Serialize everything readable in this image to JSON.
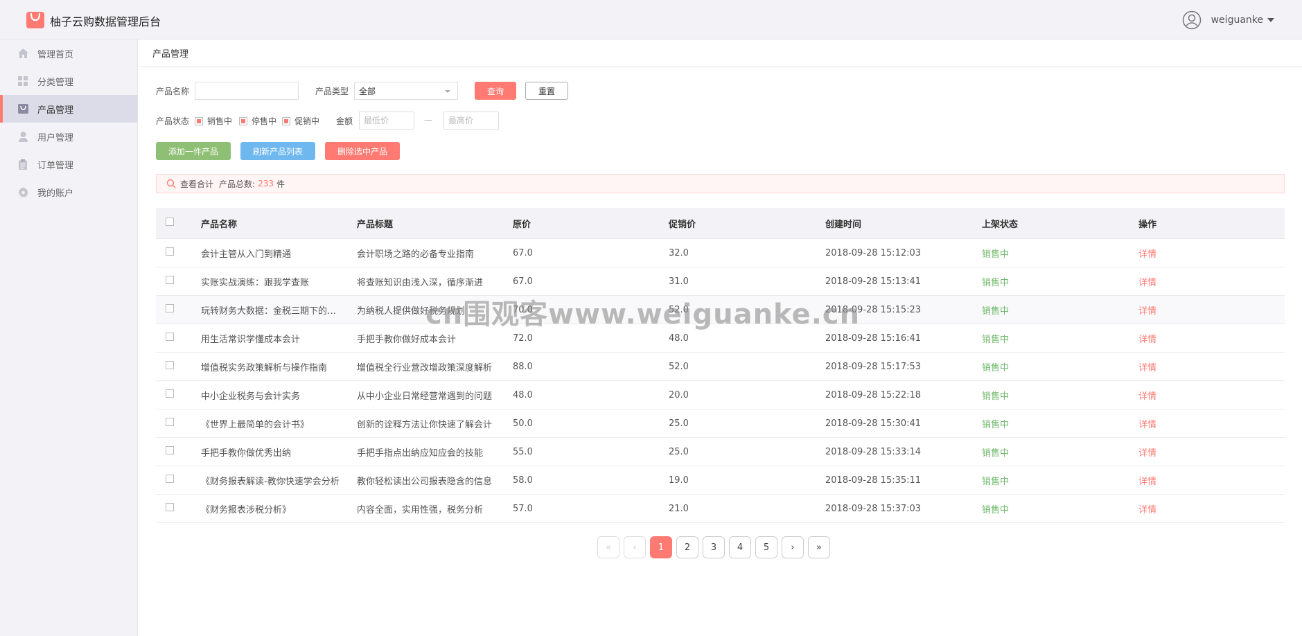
{
  "app": {
    "title": "柚子云购数据管理后台",
    "logo_color": "#ff7a72"
  },
  "user": {
    "name": "weiguanke"
  },
  "sidebar": {
    "items": [
      {
        "label": "管理首页",
        "icon": "home-icon",
        "active": false
      },
      {
        "label": "分类管理",
        "icon": "grid-icon",
        "active": false
      },
      {
        "label": "产品管理",
        "icon": "bag-icon",
        "active": true
      },
      {
        "label": "用户管理",
        "icon": "user-icon",
        "active": false
      },
      {
        "label": "订单管理",
        "icon": "clipboard-icon",
        "active": false
      },
      {
        "label": "我的账户",
        "icon": "gear-icon",
        "active": false
      }
    ]
  },
  "breadcrumb": "产品管理",
  "filters": {
    "name_label": "产品名称",
    "name_value": "",
    "type_label": "产品类型",
    "type_value": "全部",
    "search_label": "查询",
    "reset_label": "重置",
    "status_label": "产品状态",
    "status_options": [
      "销售中",
      "停售中",
      "促销中"
    ],
    "amount_label": "金额",
    "min_placeholder": "最低价",
    "max_placeholder": "最高价",
    "dash": "—"
  },
  "actions": {
    "add": "添加一件产品",
    "refresh": "刷新产品列表",
    "delete": "删除选中产品"
  },
  "summary": {
    "title": "查看合计",
    "total_label": "产品总数:",
    "total": "233",
    "unit": "件"
  },
  "table": {
    "headers": [
      "产品名称",
      "产品标题",
      "原价",
      "促销价",
      "创建时间",
      "上架状态",
      "操作"
    ],
    "rows": [
      {
        "name": "会计主管从入门到精通",
        "title": "会计职场之路的必备专业指南",
        "price": "67.0",
        "promo": "32.0",
        "created": "2018-09-28 15:12:03",
        "status": "销售中",
        "op": "详情"
      },
      {
        "name": "实账实战演练：跟我学查账",
        "title": "将查账知识由浅入深，循序渐进",
        "price": "67.0",
        "promo": "31.0",
        "created": "2018-09-28 15:13:41",
        "status": "销售中",
        "op": "详情"
      },
      {
        "name": "玩转财务大数据：金税三期下的纳税",
        "title": "为纳税人提供做好税务规划",
        "price": "70.0",
        "promo": "52.0",
        "created": "2018-09-28 15:15:23",
        "status": "销售中",
        "op": "详情"
      },
      {
        "name": "用生活常识学懂成本会计",
        "title": "手把手教你做好成本会计",
        "price": "72.0",
        "promo": "48.0",
        "created": "2018-09-28 15:16:41",
        "status": "销售中",
        "op": "详情"
      },
      {
        "name": "增值税实务政策解析与操作指南",
        "title": "增值税全行业营改增政策深度解析",
        "price": "88.0",
        "promo": "52.0",
        "created": "2018-09-28 15:17:53",
        "status": "销售中",
        "op": "详情"
      },
      {
        "name": "中小企业税务与会计实务",
        "title": "从中小企业日常经营常遇到的问题",
        "price": "48.0",
        "promo": "20.0",
        "created": "2018-09-28 15:22:18",
        "status": "销售中",
        "op": "详情"
      },
      {
        "name": "《世界上最简单的会计书》",
        "title": "创新的诠释方法让你快速了解会计",
        "price": "50.0",
        "promo": "25.0",
        "created": "2018-09-28 15:30:41",
        "status": "销售中",
        "op": "详情"
      },
      {
        "name": "手把手教你做优秀出纳",
        "title": "手把手指点出纳应知应会的技能",
        "price": "55.0",
        "promo": "25.0",
        "created": "2018-09-28 15:33:14",
        "status": "销售中",
        "op": "详情"
      },
      {
        "name": "《财务报表解读-教你快速学会分析",
        "title": "教你轻松读出公司报表隐含的信息",
        "price": "58.0",
        "promo": "19.0",
        "created": "2018-09-28 15:35:11",
        "status": "销售中",
        "op": "详情"
      },
      {
        "name": "《财务报表涉税分析》",
        "title": "内容全面，实用性强，税务分析",
        "price": "57.0",
        "promo": "21.0",
        "created": "2018-09-28 15:37:03",
        "status": "销售中",
        "op": "详情"
      }
    ]
  },
  "pagination": {
    "first": "«",
    "prev": "‹",
    "pages": [
      "1",
      "2",
      "3",
      "4",
      "5"
    ],
    "current": "1",
    "next": "›",
    "last": "»"
  },
  "watermark": "cn围观客www.weiguanke.cn"
}
